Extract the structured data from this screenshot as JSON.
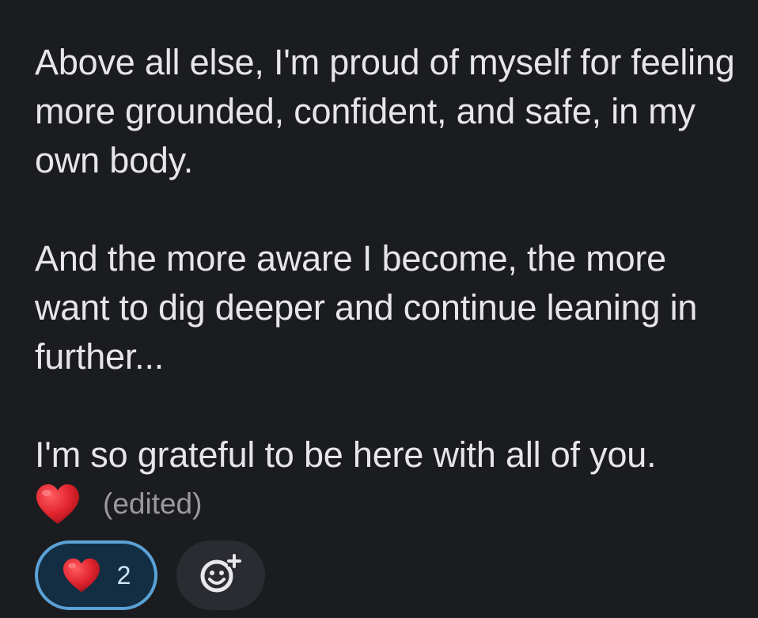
{
  "message": {
    "paragraphs": [
      "Above all else, I'm proud of myself for feeling more grounded, confident, and safe, in my own body.",
      "And the more aware I become, the more want to dig deeper and continue leaning in further...",
      "I'm so grateful to be here with all of you."
    ],
    "trailing_emoji": "red-heart-icon",
    "edited_label": "(edited)"
  },
  "reactions": {
    "items": [
      {
        "emoji": "red-heart-icon",
        "count": "2",
        "selected": true
      }
    ],
    "add_reaction_icon": "add-reaction-icon"
  },
  "colors": {
    "background": "#1b1c20",
    "text": "#e6e6e8",
    "muted": "#9a9a9e",
    "heart": "#e0242e",
    "selected_border": "#5aa2d6",
    "selected_fill": "#132d42"
  }
}
